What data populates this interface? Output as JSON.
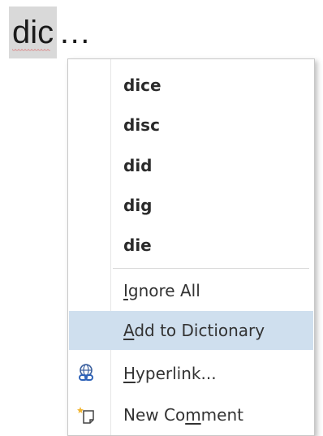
{
  "document": {
    "misspelled_word": "dic",
    "trailing_text": "…"
  },
  "context_menu": {
    "suggestions": [
      {
        "label": "dice"
      },
      {
        "label": "disc"
      },
      {
        "label": "did"
      },
      {
        "label": "dig"
      },
      {
        "label": "die"
      }
    ],
    "actions": {
      "ignore_all": {
        "prefix": "",
        "underlined": "I",
        "suffix": "gnore All"
      },
      "add_to_dictionary": {
        "prefix": "",
        "underlined": "A",
        "suffix": "dd to Dictionary",
        "highlighted": true
      },
      "hyperlink": {
        "prefix": "",
        "underlined": "H",
        "suffix": "yperlink...",
        "icon": "hyperlink-globe-icon"
      },
      "new_comment": {
        "prefix": "New Co",
        "underlined": "m",
        "suffix": "ment",
        "icon": "new-comment-icon"
      }
    },
    "colors": {
      "highlight": "#cfdfee",
      "selection": "#d9d9d9",
      "spell_underline": "#e02020"
    }
  }
}
